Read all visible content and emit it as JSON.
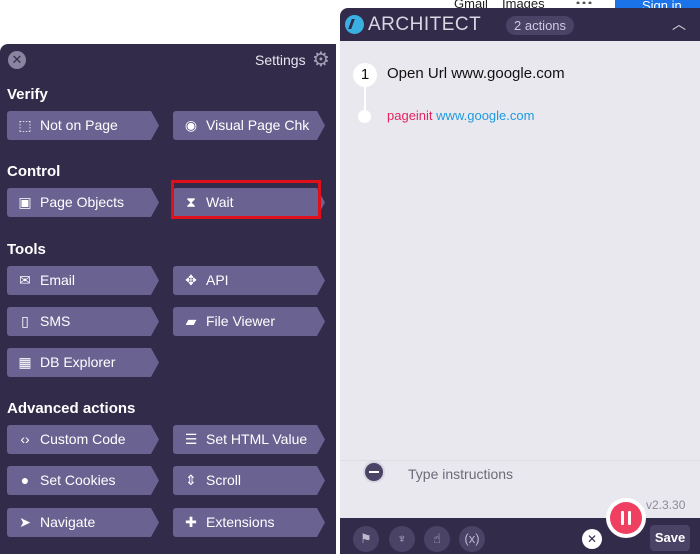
{
  "google_bar": {
    "gmail": "Gmail",
    "images": "Images",
    "sign_in": "Sign in"
  },
  "settings": {
    "title": "Settings",
    "sections": {
      "verify": {
        "title": "Verify",
        "not_on_page": "Not on Page",
        "visual_page_chk": "Visual Page Chk"
      },
      "control": {
        "title": "Control",
        "page_objects": "Page Objects",
        "wait": "Wait"
      },
      "tools": {
        "title": "Tools",
        "email": "Email",
        "api": "API",
        "sms": "SMS",
        "file_viewer": "File Viewer",
        "db_explorer": "DB Explorer"
      },
      "advanced": {
        "title": "Advanced actions",
        "custom_code": "Custom Code",
        "set_html_value": "Set HTML Value",
        "set_cookies": "Set Cookies",
        "scroll": "Scroll",
        "navigate": "Navigate",
        "extensions": "Extensions"
      }
    },
    "highlight_color": "#e0101a"
  },
  "architect": {
    "title": "ARCHITECT",
    "actions_count": "2 actions",
    "steps": [
      {
        "number": "1",
        "title": "Open Url www.google.com",
        "sub_key": "pageinit",
        "sub_value": "www.google.com"
      }
    ],
    "instructions_placeholder": "Type instructions",
    "version": "v2.3.30",
    "footer": {
      "variables_label": "(x)",
      "save_label": "Save"
    },
    "colors": {
      "accent": "#f04061",
      "link": "#1e9be0",
      "key": "#e5245e"
    }
  },
  "icons": {
    "settings_close": "close-icon",
    "gear": "gear-icon",
    "not_on_page": "dashed-square-icon",
    "visual_page_chk": "eye-icon",
    "page_objects": "chip-icon",
    "wait": "hourglass-icon",
    "email": "envelope-icon",
    "api": "move-arrows-icon",
    "sms": "phone-icon",
    "file_viewer": "folder-icon",
    "db_explorer": "table-icon",
    "custom_code": "code-icon",
    "set_html_value": "list-icon",
    "set_cookies": "cookie-icon",
    "scroll": "scroll-arrows-icon",
    "navigate": "navigation-arrow-icon",
    "extensions": "puzzle-icon",
    "flag": "flag-icon",
    "plant": "plant-icon",
    "pointer": "pointer-icon"
  }
}
